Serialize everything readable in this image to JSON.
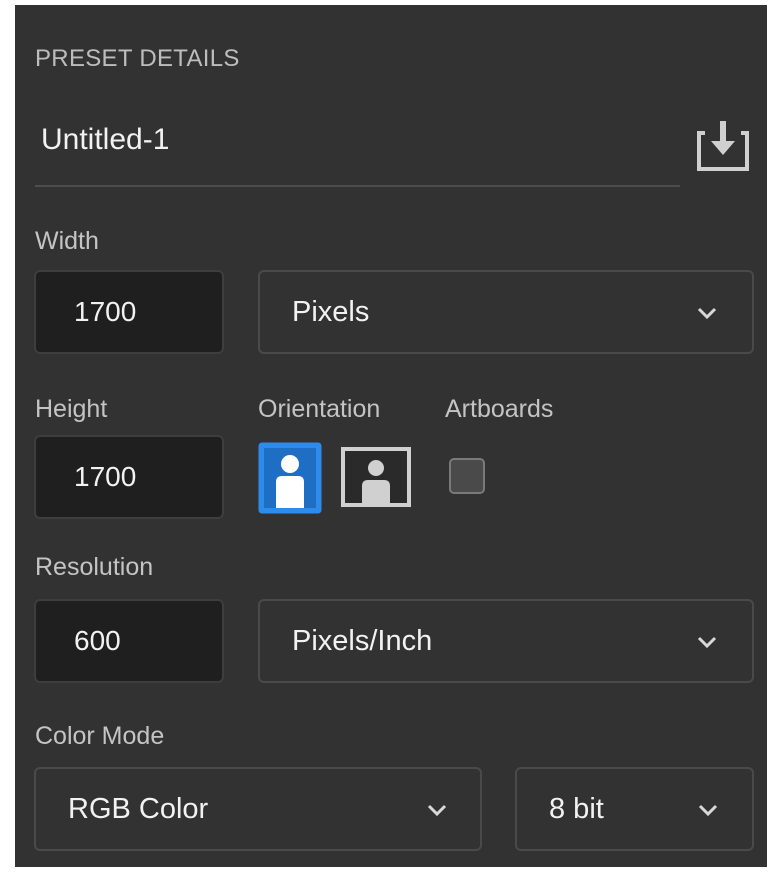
{
  "preset_details": {
    "section_title": "PRESET DETAILS",
    "name": "Untitled-1",
    "save_icon": "save-preset-icon"
  },
  "width": {
    "label": "Width",
    "value": "1700",
    "unit": "Pixels"
  },
  "height": {
    "label": "Height",
    "value": "1700"
  },
  "orientation": {
    "label": "Orientation",
    "selected": "portrait",
    "options": [
      "portrait",
      "landscape"
    ]
  },
  "artboards": {
    "label": "Artboards",
    "checked": false
  },
  "resolution": {
    "label": "Resolution",
    "value": "600",
    "unit": "Pixels/Inch"
  },
  "color_mode": {
    "label": "Color Mode",
    "mode": "RGB Color",
    "bit_depth": "8 bit"
  },
  "colors": {
    "panel_bg": "#323232",
    "field_bg": "#1f1f1f",
    "accent": "#2d8ceb",
    "text": "#f2f2f2",
    "label_text": "#c4c4c4"
  }
}
